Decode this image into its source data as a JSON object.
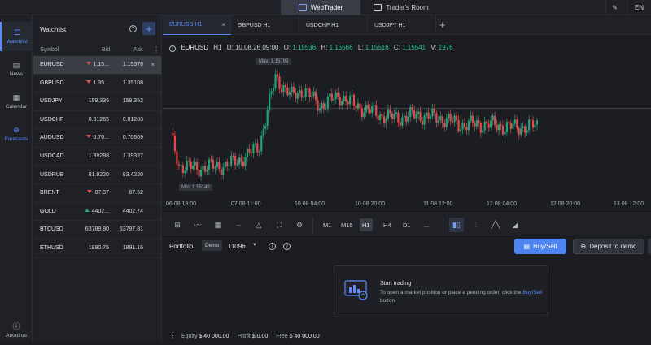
{
  "top_nav": {
    "webtrader_label": "WebTrader",
    "traders_room_label": "Trader's Room",
    "language": "EN"
  },
  "rail": {
    "items": [
      {
        "label": "Watchlist",
        "icon": "watchlist-icon"
      },
      {
        "label": "News",
        "icon": "news-icon"
      },
      {
        "label": "Calendar",
        "icon": "calendar-icon"
      },
      {
        "label": "Forecasts",
        "icon": "forecasts-icon"
      }
    ],
    "about": "About us"
  },
  "watchlist": {
    "title": "Watchlist",
    "help": "?",
    "add": "+",
    "menu": "⋮",
    "columns": {
      "symbol": "Symbol",
      "bid": "Bid",
      "ask": "Ask"
    },
    "rows": [
      {
        "symbol": "EURUSD",
        "bid": "1.15...",
        "ask": "1.15378",
        "trend": "down"
      },
      {
        "symbol": "GBPUSD",
        "bid": "1.35...",
        "ask": "1.35108",
        "trend": "down"
      },
      {
        "symbol": "USDJPY",
        "bid": "159.336",
        "ask": "159.352",
        "trend": ""
      },
      {
        "symbol": "USDCHF",
        "bid": "0.81265",
        "ask": "0.81283",
        "trend": ""
      },
      {
        "symbol": "AUDUSD",
        "bid": "0.70...",
        "ask": "0.70609",
        "trend": "down"
      },
      {
        "symbol": "USDCAD",
        "bid": "1.39298",
        "ask": "1.39327",
        "trend": ""
      },
      {
        "symbol": "USDRUB",
        "bid": "81.9220",
        "ask": "83.4220",
        "trend": ""
      },
      {
        "symbol": "BRENT",
        "bid": "87.37",
        "ask": "87.52",
        "trend": "down"
      },
      {
        "symbol": "GOLD",
        "bid": "4402...",
        "ask": "4402.74",
        "trend": "up"
      },
      {
        "symbol": "BTCUSD",
        "bid": "63789.80",
        "ask": "63797.81",
        "trend": ""
      },
      {
        "symbol": "ETHUSD",
        "bid": "1890.75",
        "ask": "1891.16",
        "trend": ""
      }
    ],
    "remove": "×"
  },
  "tabs": {
    "items": [
      "EURUSD H1",
      "GBPUSD H1",
      "USDCHF H1",
      "USDJPY H1"
    ],
    "close": "×",
    "add": "+"
  },
  "chart_header": {
    "symbol": "EURUSD",
    "timeframe": "H1",
    "d_label": "D:",
    "d_value": "10.08.26 09:00",
    "o_label": "O:",
    "o_value": "1.15536",
    "h_label": "H:",
    "h_value": "1.15566",
    "l_label": "L:",
    "l_value": "1.15516",
    "c_label": "C:",
    "c_value": "1.15541",
    "v_label": "V:",
    "v_value": "1976"
  },
  "chart_data": {
    "type": "candlestick",
    "max_label": "Max. 1.15799",
    "min_label": "Min. 1.15140",
    "ylim": [
      1.151,
      1.1585
    ],
    "x_ticks": [
      "06.08 19:00",
      "07.08 11:00",
      "10.08 04:00",
      "10.08 20:00",
      "11.08 12:00",
      "12.08 04:00",
      "12.08 20:00",
      "13.08 12:00"
    ],
    "current_price": 1.15541,
    "colors": {
      "up": "#26a17b",
      "down": "#e24b4b"
    }
  },
  "toolbar": {
    "timeframes": [
      "M1",
      "M15",
      "H1",
      "H4",
      "D1",
      "..."
    ],
    "active_timeframe": "H1"
  },
  "portfolio": {
    "title": "Portfolio",
    "demo_badge": "Demo",
    "account": "11096",
    "buy_sell": "Buy/Sell",
    "deposit": "Deposit to demo",
    "empty_title": "Start trading",
    "empty_text": "To open a market position or place a pending order, click the",
    "empty_link": "Buy/Sell",
    "empty_suffix": "button",
    "equity_label": "Equity",
    "equity_value": "$ 40 000.00",
    "profit_label": "Profit",
    "profit_value": "$ 0.00",
    "free_label": "Free",
    "free_value": "$ 40 000.00"
  }
}
